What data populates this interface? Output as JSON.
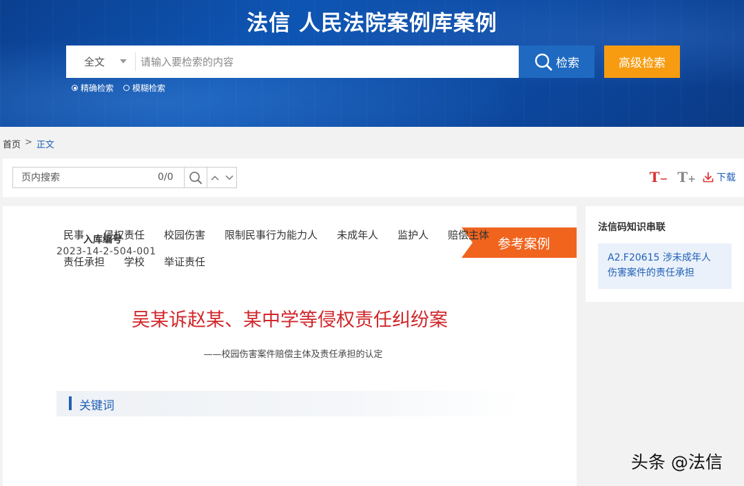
{
  "header": {
    "title": "法信 人民法院案例库案例",
    "search": {
      "scope": "全文",
      "placeholder": "请输入要检索的内容",
      "search_label": "检索",
      "advanced_label": "高级检索"
    },
    "modes": [
      {
        "label": "精确检索",
        "selected": true
      },
      {
        "label": "模糊检索",
        "selected": false
      }
    ]
  },
  "breadcrumb": {
    "home": "首页",
    "separator": ">",
    "current": "正文"
  },
  "toolbar": {
    "find_placeholder": "页内搜索",
    "find_count": "0/0",
    "font_decrease": "T",
    "font_decrease_sign": "−",
    "font_increase": "T",
    "font_increase_sign": "+",
    "download_label": "下载"
  },
  "case": {
    "number_label": "入库编号",
    "number": "2023-14-2-504-001",
    "tag": "参考案例",
    "title": "吴某诉赵某、某中学等侵权责任纠纷案",
    "subtitle": "——校园伤害案件赔偿主体及责任承担的认定",
    "keywords_title": "关键词",
    "keywords": [
      "民事",
      "侵权责任",
      "校园伤害",
      "限制民事行为能力人",
      "未成年人",
      "监护人",
      "赔偿主体",
      "责任承担",
      "学校",
      "举证责任"
    ]
  },
  "sidebar": {
    "title": "法信码知识串联",
    "items": [
      {
        "line1": "A2.F20615 涉未成年人",
        "line2": "伤害案件的责任承担"
      }
    ]
  },
  "watermark": "头条 @法信",
  "colors": {
    "header_blue": "#0d4aa2",
    "search_button": "#1f6ac0",
    "advanced_button": "#f79c11",
    "tag_orange": "#f0641e",
    "title_red": "#d0262a",
    "link_blue": "#1f5fb5"
  }
}
